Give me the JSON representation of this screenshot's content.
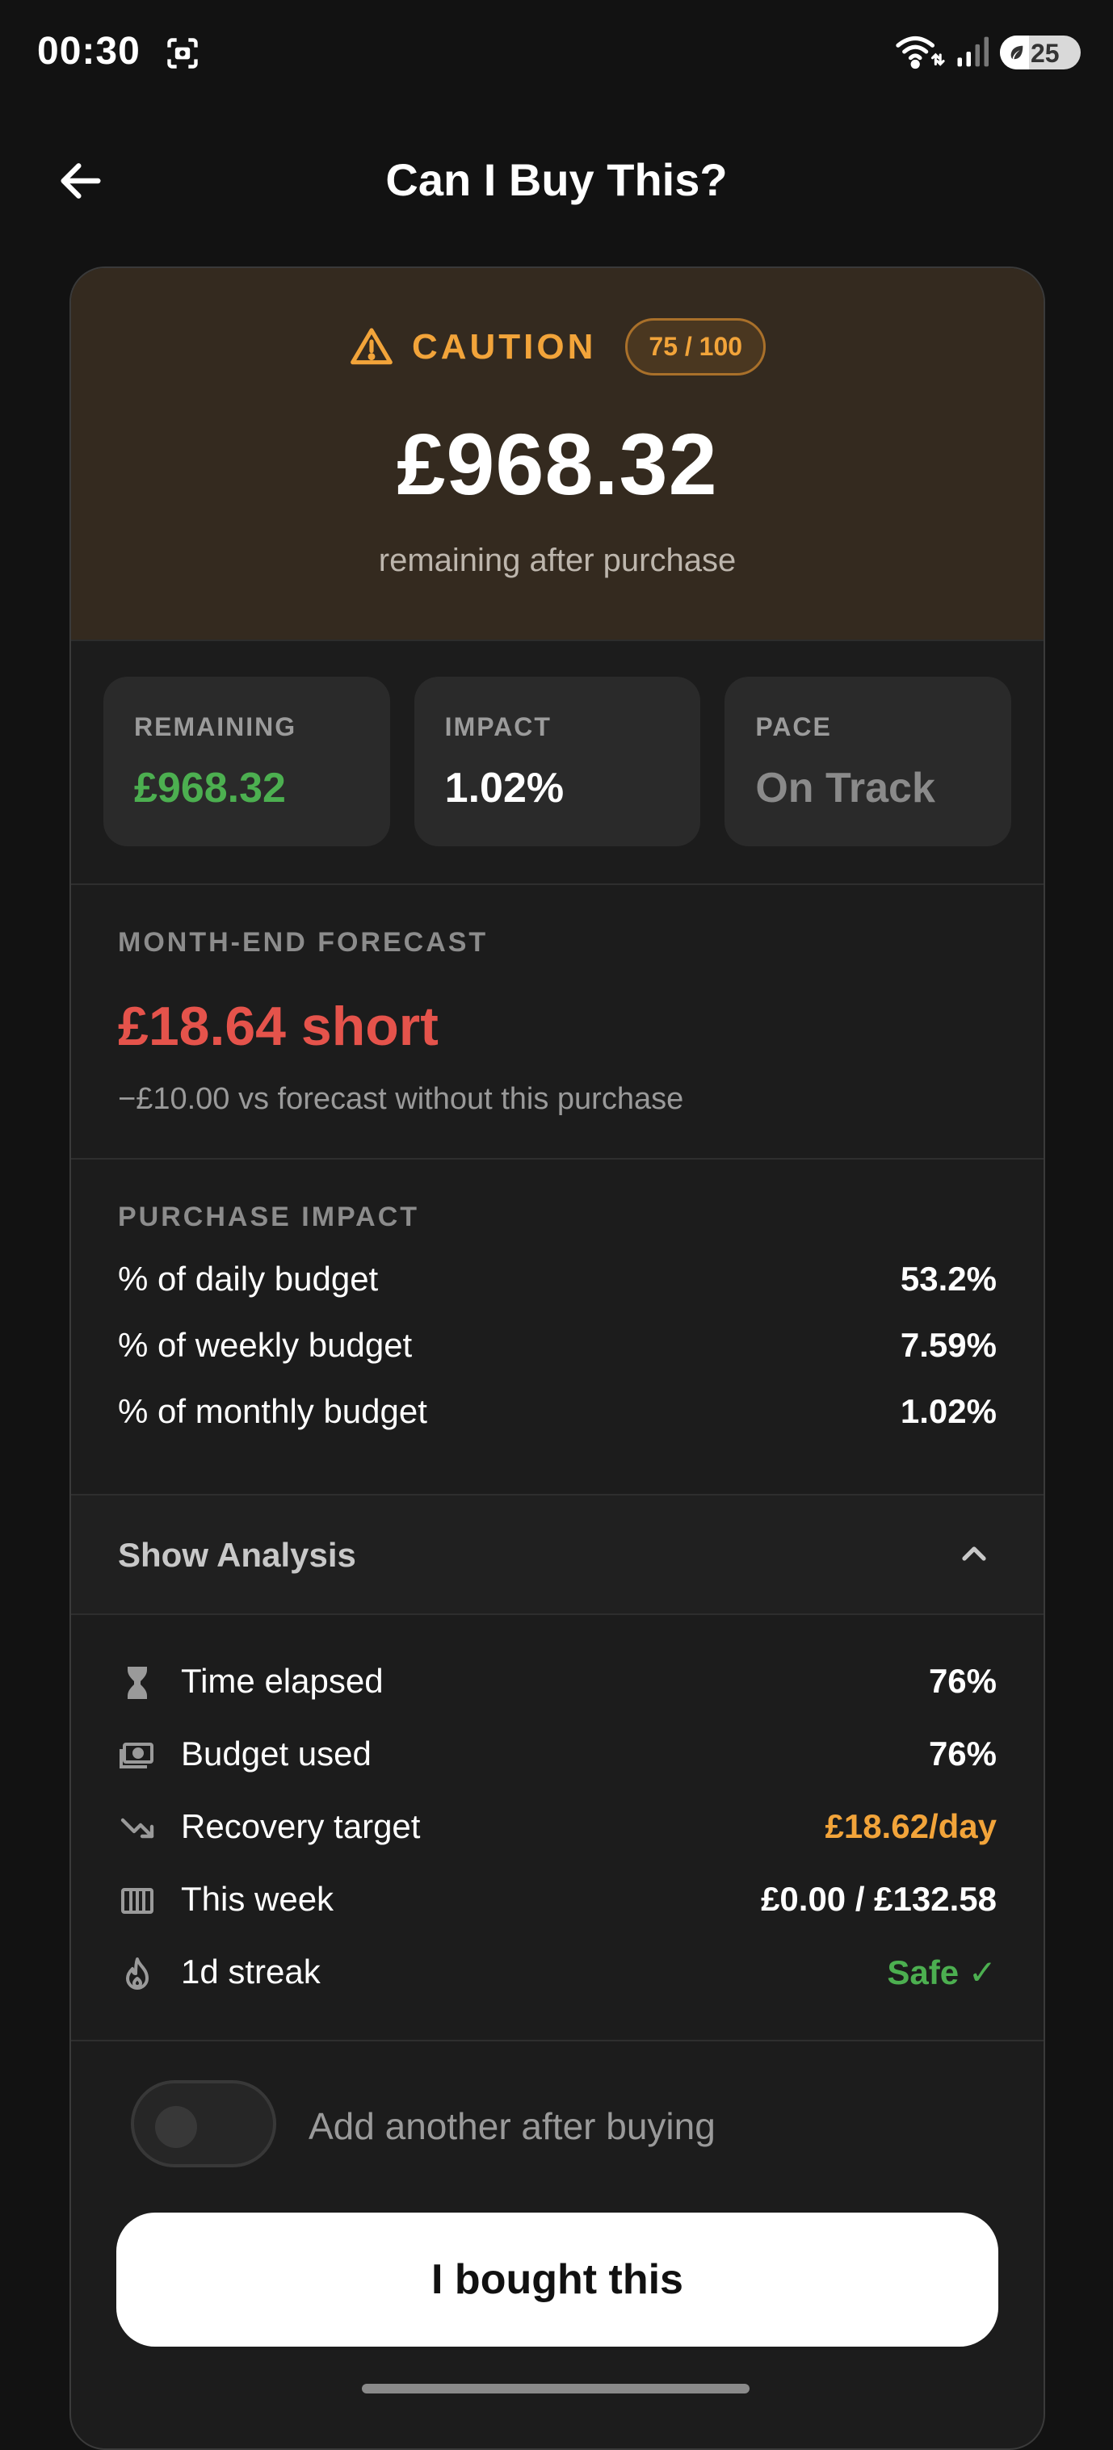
{
  "status_bar": {
    "time": "00:30",
    "battery": "25",
    "wifi_badge": "6"
  },
  "header": {
    "title": "Can I Buy This?"
  },
  "verdict": {
    "label": "CAUTION",
    "score": "75 / 100",
    "amount": "£968.32",
    "subtitle": "remaining after purchase",
    "color": "#f2a43a"
  },
  "stats": [
    {
      "label": "REMAINING",
      "value": "£968.32",
      "color": "#4caf50"
    },
    {
      "label": "IMPACT",
      "value": "1.02%",
      "color": "#ffffff"
    },
    {
      "label": "PACE",
      "value": "On Track",
      "color": "#8a8a8a"
    }
  ],
  "forecast": {
    "label": "MONTH-END FORECAST",
    "value": "£18.64 short",
    "note": "−£10.00 vs forecast without this purchase",
    "color": "#e5534b"
  },
  "purchase_impact": {
    "label": "PURCHASE IMPACT",
    "rows": [
      {
        "label": "% of daily budget",
        "value": "53.2%"
      },
      {
        "label": "% of weekly budget",
        "value": "7.59%"
      },
      {
        "label": "% of monthly budget",
        "value": "1.02%"
      }
    ]
  },
  "analysis": {
    "toggle_label": "Show Analysis",
    "rows": [
      {
        "icon": "hourglass-icon",
        "label": "Time elapsed",
        "value": "76%",
        "color": "#ffffff"
      },
      {
        "icon": "cash-icon",
        "label": "Budget used",
        "value": "76%",
        "color": "#ffffff"
      },
      {
        "icon": "trending-down-icon",
        "label": "Recovery target",
        "value": "£18.62/day",
        "color": "#f2a43a"
      },
      {
        "icon": "calendar-week-icon",
        "label": "This week",
        "value": "£0.00 / £132.58",
        "color": "#ffffff"
      },
      {
        "icon": "flame-icon",
        "label": "1d streak",
        "value": "Safe ✓",
        "color": "#4caf50"
      }
    ]
  },
  "add_another": {
    "label": "Add another after buying",
    "enabled": false
  },
  "primary_button": {
    "label": "I bought this"
  }
}
